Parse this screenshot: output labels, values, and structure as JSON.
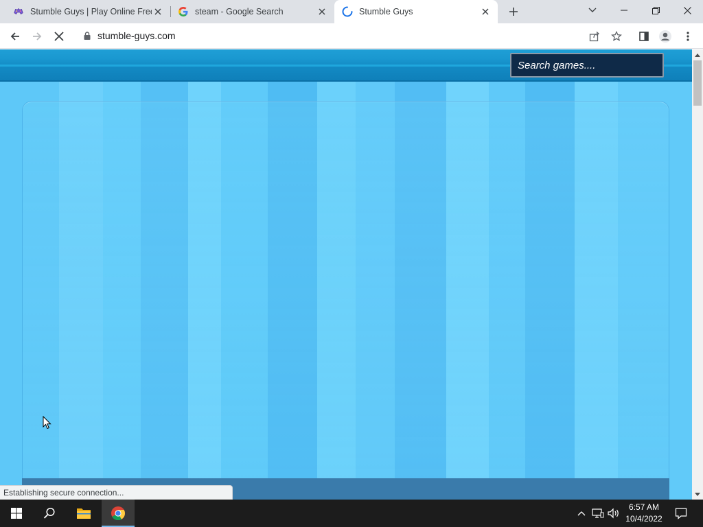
{
  "browser": {
    "tabs": [
      {
        "title": "Stumble Guys | Play Online Free",
        "favicon": "stumble-guys-favicon",
        "active": false
      },
      {
        "title": "steam - Google Search",
        "favicon": "google-g-icon",
        "active": false
      },
      {
        "title": "Stumble Guys",
        "favicon": "loading-spinner-icon",
        "active": true
      }
    ],
    "address_bar": {
      "url": "stumble-guys.com",
      "icon": "lock-icon"
    },
    "status_text": "Establishing secure connection..."
  },
  "page": {
    "search": {
      "placeholder": "Search games...."
    },
    "colors": {
      "header": "#1a98d0",
      "search_bg": "#0f2a48",
      "background": "#5ec8f8",
      "frame_bar": "#3a7bab"
    }
  },
  "taskbar": {
    "apps": [
      {
        "name": "start",
        "icon": "windows-logo-icon"
      },
      {
        "name": "search",
        "icon": "search-icon"
      },
      {
        "name": "file-explorer",
        "icon": "folder-icon"
      },
      {
        "name": "chrome",
        "icon": "chrome-icon",
        "active": true
      }
    ],
    "clock": {
      "time": "6:57 AM",
      "date": "10/4/2022"
    }
  }
}
